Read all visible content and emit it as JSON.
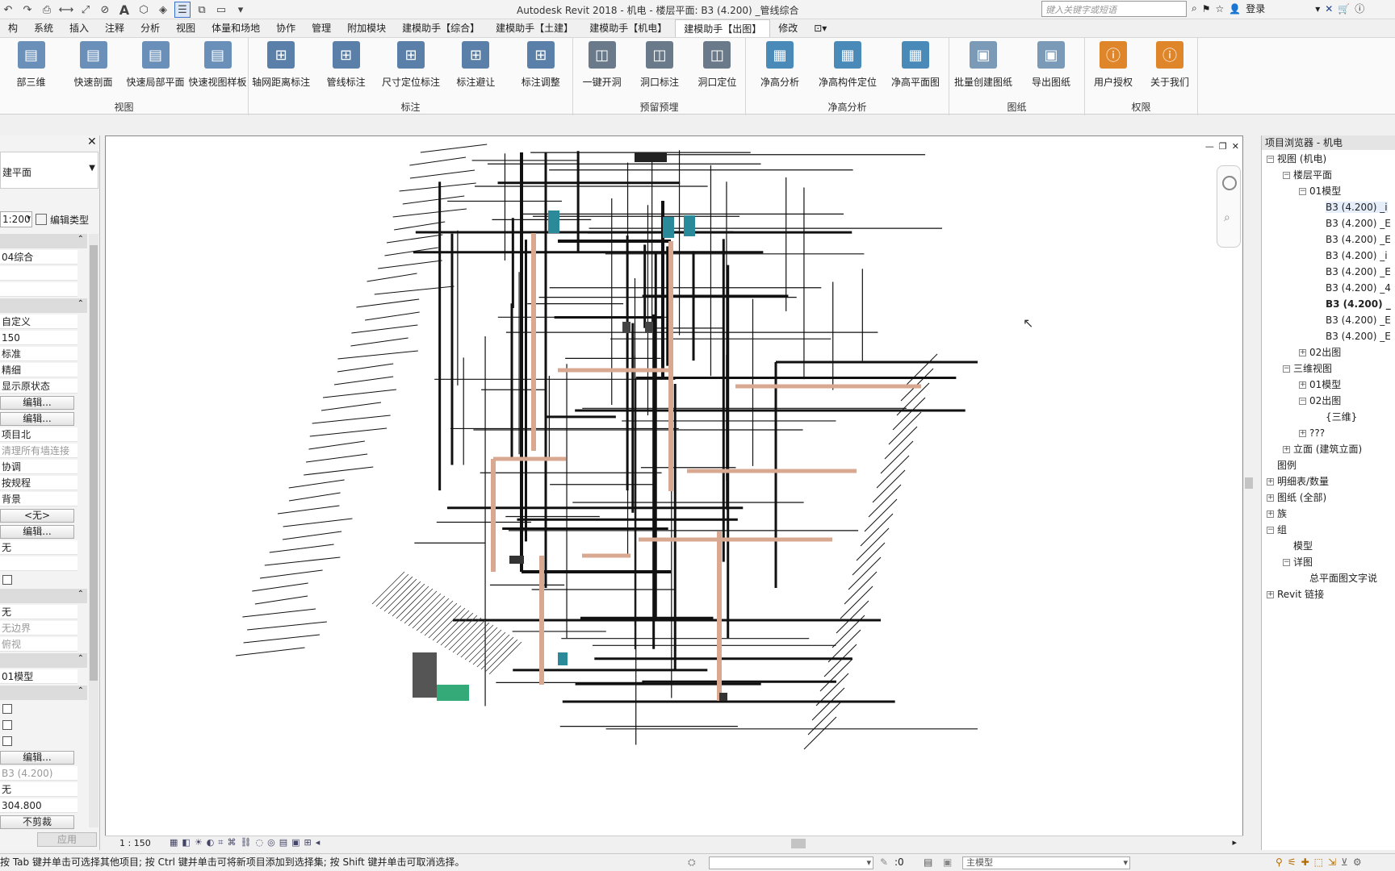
{
  "window": {
    "title": "Autodesk Revit 2018 -    机电 - 楼层平面: B3  (4.200)  _管线综合",
    "search_placeholder": "键入关键字或短语",
    "login_label": "登录"
  },
  "tabs": [
    {
      "label": "构"
    },
    {
      "label": "系统"
    },
    {
      "label": "插入"
    },
    {
      "label": "注释"
    },
    {
      "label": "分析"
    },
    {
      "label": "视图"
    },
    {
      "label": "体量和场地"
    },
    {
      "label": "协作"
    },
    {
      "label": "管理"
    },
    {
      "label": "附加模块"
    },
    {
      "label": "建模助手【综合】"
    },
    {
      "label": "建模助手【土建】"
    },
    {
      "label": "建模助手【机电】"
    },
    {
      "label": "建模助手【出图】"
    },
    {
      "label": "修改"
    }
  ],
  "ribbon": {
    "groups": [
      {
        "label": "视图",
        "buttons": [
          "部三维",
          "快速剖面",
          "快速局部平面",
          "快速视图样板"
        ]
      },
      {
        "label": "标注",
        "buttons": [
          "轴网距离标注",
          "管线标注",
          "尺寸定位标注",
          "标注避让",
          "标注调整"
        ]
      },
      {
        "label": "预留预埋",
        "buttons": [
          "一键开洞",
          "洞口标注",
          "洞口定位"
        ]
      },
      {
        "label": "净高分析",
        "buttons": [
          "净高分析",
          "净高构件定位",
          "净高平面图"
        ]
      },
      {
        "label": "图纸",
        "buttons": [
          "批量创建图纸",
          "导出图纸"
        ]
      },
      {
        "label": "权限",
        "buttons": [
          "用户授权",
          "关于我们"
        ]
      }
    ]
  },
  "properties": {
    "type_value": "建平面",
    "scale_value": "1:200",
    "edit_type_label": "编辑类型",
    "view_template": "04综合",
    "rows": [
      {
        "text": "自定义",
        "grey": false
      },
      {
        "text": "150",
        "grey": false
      },
      {
        "text": "标准",
        "grey": false
      },
      {
        "text": "精细",
        "grey": false
      },
      {
        "text": "显示原状态",
        "grey": false
      }
    ],
    "edit_label": "编辑...",
    "rows2": [
      {
        "text": "项目北",
        "grey": false
      },
      {
        "text": "清理所有墙连接",
        "grey": true
      },
      {
        "text": "协调",
        "grey": false
      },
      {
        "text": "按规程",
        "grey": false
      },
      {
        "text": "背景",
        "grey": false
      }
    ],
    "none_btn": "<无>",
    "none_text": "无",
    "rows3": [
      {
        "text": "无",
        "grey": false
      },
      {
        "text": "无边界",
        "grey": true
      },
      {
        "text": "俯视",
        "grey": true
      }
    ],
    "subdiscipline": "01模型",
    "level_value": "B3  (4.200)",
    "none2": "无",
    "elevation": "304.800",
    "no_crop_label": "不剪裁",
    "apply_label": "应用"
  },
  "browser": {
    "title": "项目浏览器 - 机电",
    "nodes": [
      {
        "text": "视图 (机电)",
        "indent": 0,
        "expander": "−",
        "bold": false
      },
      {
        "text": "楼层平面",
        "indent": 1,
        "expander": "−",
        "bold": false
      },
      {
        "text": "01模型",
        "indent": 2,
        "expander": "−",
        "bold": false
      },
      {
        "text": "B3  (4.200)  _i",
        "indent": 3,
        "expander": "",
        "bold": false
      },
      {
        "text": "B3  (4.200)  _E",
        "indent": 3,
        "expander": "",
        "bold": false
      },
      {
        "text": "B3  (4.200)  _E",
        "indent": 3,
        "expander": "",
        "bold": false
      },
      {
        "text": "B3  (4.200)  _i",
        "indent": 3,
        "expander": "",
        "bold": false
      },
      {
        "text": "B3  (4.200)  _E",
        "indent": 3,
        "expander": "",
        "bold": false
      },
      {
        "text": "B3  (4.200)  _4",
        "indent": 3,
        "expander": "",
        "bold": false
      },
      {
        "text": "B3  (4.200)  _",
        "indent": 3,
        "expander": "",
        "bold": true
      },
      {
        "text": "B3  (4.200)  _E",
        "indent": 3,
        "expander": "",
        "bold": false
      },
      {
        "text": "B3  (4.200)  _E",
        "indent": 3,
        "expander": "",
        "bold": false
      },
      {
        "text": "02出图",
        "indent": 2,
        "expander": "+",
        "bold": false
      },
      {
        "text": "三维视图",
        "indent": 1,
        "expander": "−",
        "bold": false
      },
      {
        "text": "01模型",
        "indent": 2,
        "expander": "+",
        "bold": false
      },
      {
        "text": "02出图",
        "indent": 2,
        "expander": "−",
        "bold": false
      },
      {
        "text": "{三维}",
        "indent": 3,
        "expander": "",
        "bold": false
      },
      {
        "text": "???",
        "indent": 2,
        "expander": "+",
        "bold": false
      },
      {
        "text": "立面 (建筑立面)",
        "indent": 1,
        "expander": "+",
        "bold": false
      },
      {
        "text": "图例",
        "indent": 0,
        "expander": "",
        "bold": false
      },
      {
        "text": "明细表/数量",
        "indent": 0,
        "expander": "+",
        "bold": false
      },
      {
        "text": "图纸 (全部)",
        "indent": 0,
        "expander": "+",
        "bold": false
      },
      {
        "text": "族",
        "indent": 0,
        "expander": "+",
        "bold": false
      },
      {
        "text": "组",
        "indent": 0,
        "expander": "−",
        "bold": false
      },
      {
        "text": "模型",
        "indent": 1,
        "expander": "",
        "bold": false
      },
      {
        "text": "详图",
        "indent": 1,
        "expander": "−",
        "bold": false
      },
      {
        "text": "总平面图文字说",
        "indent": 2,
        "expander": "",
        "bold": false
      },
      {
        "text": "Revit 链接",
        "indent": 0,
        "expander": "+",
        "bold": false
      }
    ]
  },
  "viewbar": {
    "scale": "1 : 150"
  },
  "statusbar": {
    "message": "按 Tab 键并单击可选择其他项目; 按 Ctrl 键并单击可将新项目添加到选择集; 按 Shift 键并单击可取消选择。",
    "count": ":0",
    "model_label": "主模型"
  }
}
